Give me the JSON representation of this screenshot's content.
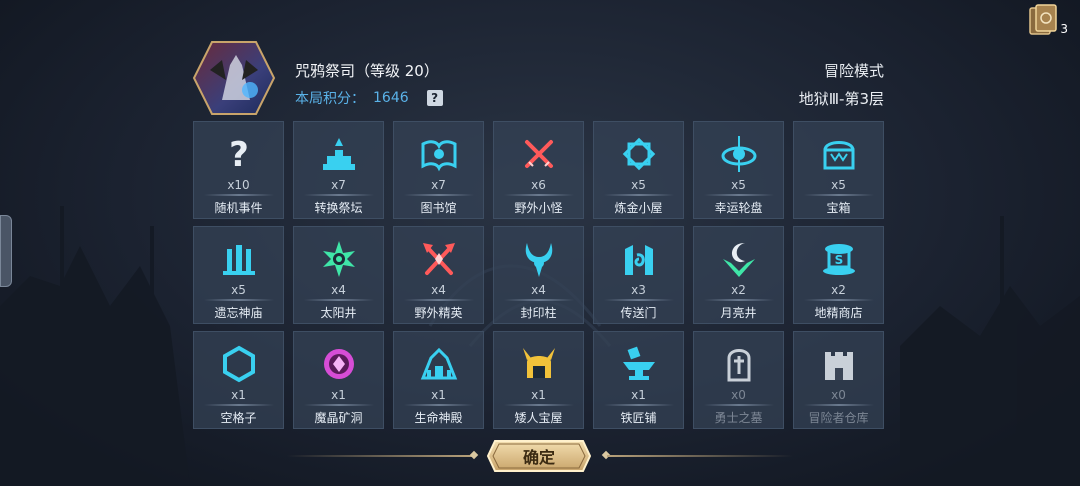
{
  "header": {
    "boss_name": "咒鸦祭司（等级 20）",
    "score_label": "本局积分：",
    "score_value": "1646",
    "help_glyph": "?",
    "mode": "冒险模式",
    "floor": "地狱Ⅲ-第3层"
  },
  "corner": {
    "card_count": "3",
    "icon": "cards-icon"
  },
  "tiles": [
    {
      "count": "x10",
      "label": "随机事件",
      "icon": "question-icon",
      "color": "#e8eef4"
    },
    {
      "count": "x7",
      "label": "转换祭坛",
      "icon": "altar-icon",
      "color": "#39d0f0"
    },
    {
      "count": "x7",
      "label": "图书馆",
      "icon": "book-icon",
      "color": "#39d0f0"
    },
    {
      "count": "x6",
      "label": "野外小怪",
      "icon": "crossed-swords-icon",
      "color": "#ff5a5a"
    },
    {
      "count": "x5",
      "label": "炼金小屋",
      "icon": "alchemy-icon",
      "color": "#39d0f0"
    },
    {
      "count": "x5",
      "label": "幸运轮盘",
      "icon": "roulette-icon",
      "color": "#39d0f0"
    },
    {
      "count": "x5",
      "label": "宝箱",
      "icon": "chest-icon",
      "color": "#39d0f0"
    },
    {
      "count": "x5",
      "label": "遗忘神庙",
      "icon": "temple-icon",
      "color": "#39d0f0"
    },
    {
      "count": "x4",
      "label": "太阳井",
      "icon": "sun-icon",
      "color": "#3fe6a8"
    },
    {
      "count": "x4",
      "label": "野外精英",
      "icon": "elite-axes-icon",
      "color": "#ff5a5a"
    },
    {
      "count": "x4",
      "label": "封印柱",
      "icon": "seal-pillar-icon",
      "color": "#39d0f0"
    },
    {
      "count": "x3",
      "label": "传送门",
      "icon": "portal-icon",
      "color": "#39d0f0"
    },
    {
      "count": "x2",
      "label": "月亮井",
      "icon": "moon-icon",
      "color": "#3fe6a8"
    },
    {
      "count": "x2",
      "label": "地精商店",
      "icon": "shop-icon",
      "color": "#39d0f0"
    },
    {
      "count": "x1",
      "label": "空格子",
      "icon": "hexagon-icon",
      "color": "#39d0f0"
    },
    {
      "count": "x1",
      "label": "魔晶矿洞",
      "icon": "crystal-mine-icon",
      "color": "#d64dd6"
    },
    {
      "count": "x1",
      "label": "生命神殿",
      "icon": "life-temple-icon",
      "color": "#39d0f0"
    },
    {
      "count": "x1",
      "label": "矮人宝屋",
      "icon": "dwarf-helmet-icon",
      "color": "#f2c23a"
    },
    {
      "count": "x1",
      "label": "铁匠铺",
      "icon": "anvil-icon",
      "color": "#39d0f0"
    },
    {
      "count": "x0",
      "label": "勇士之墓",
      "icon": "tomb-icon",
      "color": "#c9d0d8"
    },
    {
      "count": "x0",
      "label": "冒险者仓库",
      "icon": "warehouse-icon",
      "color": "#c9d0d8"
    }
  ],
  "footer": {
    "confirm_label": "确定"
  }
}
